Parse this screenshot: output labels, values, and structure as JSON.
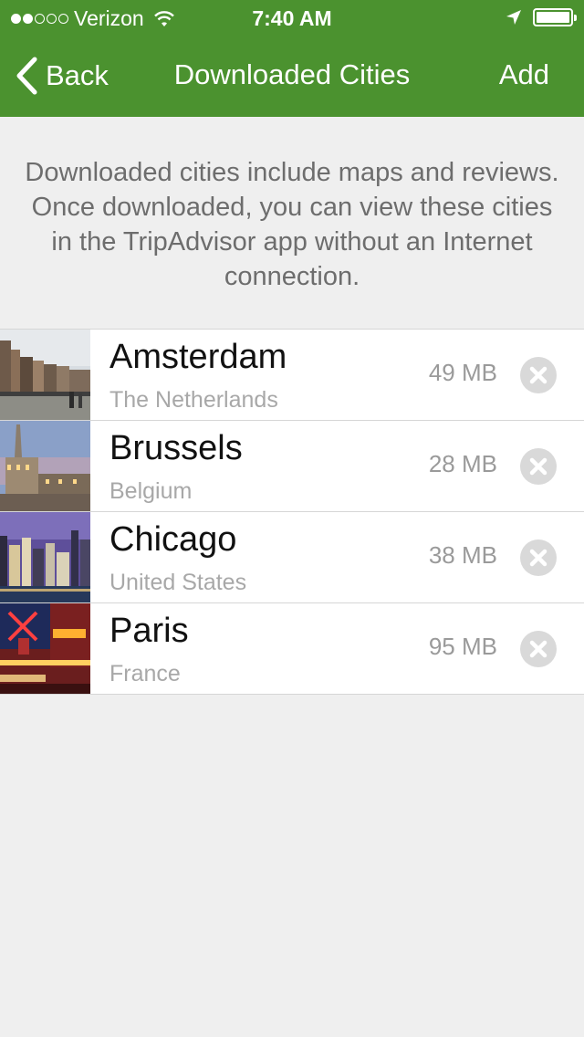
{
  "status": {
    "carrier": "Verizon",
    "time": "7:40 AM",
    "signal_bars": 2,
    "wifi_icon": "wifi-icon",
    "location_icon": "location-arrow-icon",
    "battery_level": 1.0
  },
  "nav": {
    "back_label": "Back",
    "title": "Downloaded Cities",
    "add_label": "Add"
  },
  "info_text": "Downloaded cities include maps and reviews. Once downloaded, you can view these cities in the TripAdvisor app without an Internet connection.",
  "cities": [
    {
      "name": "Amsterdam",
      "country": "The Netherlands",
      "size": "49 MB"
    },
    {
      "name": "Brussels",
      "country": "Belgium",
      "size": "28 MB"
    },
    {
      "name": "Chicago",
      "country": "United States",
      "size": "38 MB"
    },
    {
      "name": "Paris",
      "country": "France",
      "size": "95 MB"
    }
  ],
  "colors": {
    "nav_green": "#4b922f",
    "background": "#efefef"
  }
}
